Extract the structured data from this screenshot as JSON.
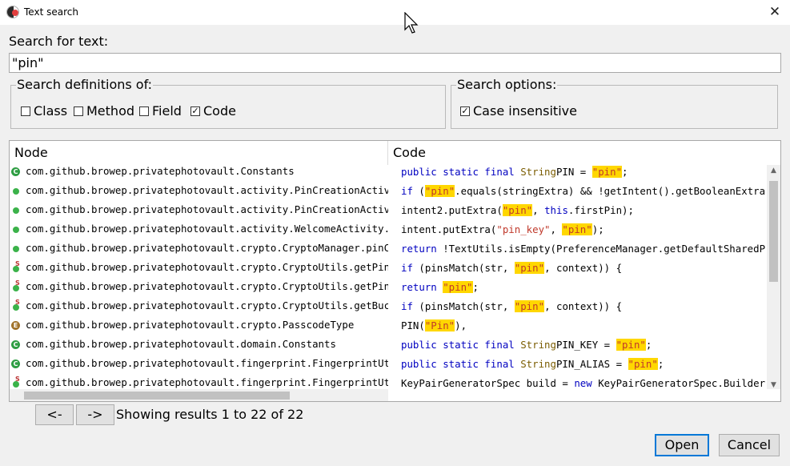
{
  "window": {
    "title": "Text search",
    "close_glyph": "✕"
  },
  "search": {
    "label": "Search for text:",
    "value": "\"pin\""
  },
  "definitions": {
    "legend": "Search definitions of:",
    "options": [
      {
        "label": "Class",
        "checked": false
      },
      {
        "label": "Method",
        "checked": false
      },
      {
        "label": "Field",
        "checked": false
      },
      {
        "label": "Code",
        "checked": true
      }
    ]
  },
  "search_options": {
    "legend": "Search options:",
    "options": [
      {
        "label": "Case insensitive",
        "checked": true
      }
    ]
  },
  "table": {
    "headers": {
      "node": "Node",
      "code": "Code"
    },
    "rows": [
      {
        "icon": "class-icon",
        "node": "com.github.browep.privatephotovault.Constants",
        "code": [
          [
            "kw",
            "public static final "
          ],
          [
            "ty",
            "String"
          ],
          [
            "",
            "PIN = "
          ],
          [
            "hl",
            "\"pin\""
          ],
          [
            "",
            ";"
          ]
        ]
      },
      {
        "icon": "method-icon",
        "node": "com.github.browep.privatephotovault.activity.PinCreationActivity.",
        "code": [
          [
            "kw",
            "if "
          ],
          [
            "",
            "("
          ],
          [
            "hl",
            "\"pin\""
          ],
          [
            "",
            ".equals(stringExtra) && !getIntent().getBooleanExtra(IS_N"
          ]
        ]
      },
      {
        "icon": "method-icon",
        "node": "com.github.browep.privatephotovault.activity.PinCreationActivity.",
        "code": [
          [
            "",
            "intent2.putExtra("
          ],
          [
            "hl",
            "\"pin\""
          ],
          [
            "",
            ", "
          ],
          [
            "kw",
            "this"
          ],
          [
            "",
            ".firstPin);"
          ]
        ]
      },
      {
        "icon": "method-icon",
        "node": "com.github.browep.privatephotovault.activity.WelcomeActivity.onSe",
        "code": [
          [
            "",
            "intent.putExtra("
          ],
          [
            "st",
            "\"pin_key\""
          ],
          [
            "",
            ", "
          ],
          [
            "hl",
            "\"pin\""
          ],
          [
            "",
            ");"
          ]
        ]
      },
      {
        "icon": "method-icon",
        "node": "com.github.browep.privatephotovault.crypto.CryptoManager.pinCreat",
        "code": [
          [
            "kw",
            "return "
          ],
          [
            "",
            "!TextUtils.isEmpty(PreferenceManager.getDefaultSharedPrefer"
          ]
        ]
      },
      {
        "icon": "static-method-icon",
        "node": "com.github.browep.privatephotovault.crypto.CryptoUtils.getPinKeyF",
        "code": [
          [
            "kw",
            "if "
          ],
          [
            "",
            "(pinsMatch(str, "
          ],
          [
            "hl",
            "\"pin\""
          ],
          [
            "",
            ", context)) {"
          ]
        ]
      },
      {
        "icon": "static-method-icon",
        "node": "com.github.browep.privatephotovault.crypto.CryptoUtils.getPinKeyF",
        "code": [
          [
            "kw",
            "return "
          ],
          [
            "hl",
            "\"pin\""
          ],
          [
            "",
            ";"
          ]
        ]
      },
      {
        "icon": "static-method-icon",
        "node": "com.github.browep.privatephotovault.crypto.CryptoUtils.getBucketI",
        "code": [
          [
            "kw",
            "if "
          ],
          [
            "",
            "(pinsMatch(str, "
          ],
          [
            "hl",
            "\"pin\""
          ],
          [
            "",
            ", context)) {"
          ]
        ]
      },
      {
        "icon": "enum-icon",
        "node": "com.github.browep.privatephotovault.crypto.PasscodeType",
        "code": [
          [
            "",
            "PIN("
          ],
          [
            "hl",
            "\"Pin\""
          ],
          [
            "",
            "),"
          ]
        ]
      },
      {
        "icon": "class-icon",
        "node": "com.github.browep.privatephotovault.domain.Constants",
        "code": [
          [
            "kw",
            "public static final "
          ],
          [
            "ty",
            "String"
          ],
          [
            "",
            "PIN_KEY = "
          ],
          [
            "hl",
            "\"pin\""
          ],
          [
            "",
            ";"
          ]
        ]
      },
      {
        "icon": "class-icon",
        "node": "com.github.browep.privatephotovault.fingerprint.FingerprintUt...",
        "code": [
          [
            "kw",
            "public static final "
          ],
          [
            "ty",
            "String"
          ],
          [
            "",
            "PIN_ALIAS = "
          ],
          [
            "hl",
            "\"pin\""
          ],
          [
            "",
            ";"
          ]
        ]
      },
      {
        "icon": "static-method-icon",
        "node": "com.github.browep.privatephotovault.fingerprint.FingerprintUtils.",
        "code": [
          [
            "",
            "KeyPairGeneratorSpec build = "
          ],
          [
            "kw",
            "new "
          ],
          [
            "",
            "KeyPairGeneratorSpec.Builder(con"
          ]
        ]
      }
    ]
  },
  "pager": {
    "prev_label": "<-",
    "next_label": "->",
    "status": "Showing results 1 to 22 of 22"
  },
  "buttons": {
    "open": "Open",
    "cancel": "Cancel"
  }
}
